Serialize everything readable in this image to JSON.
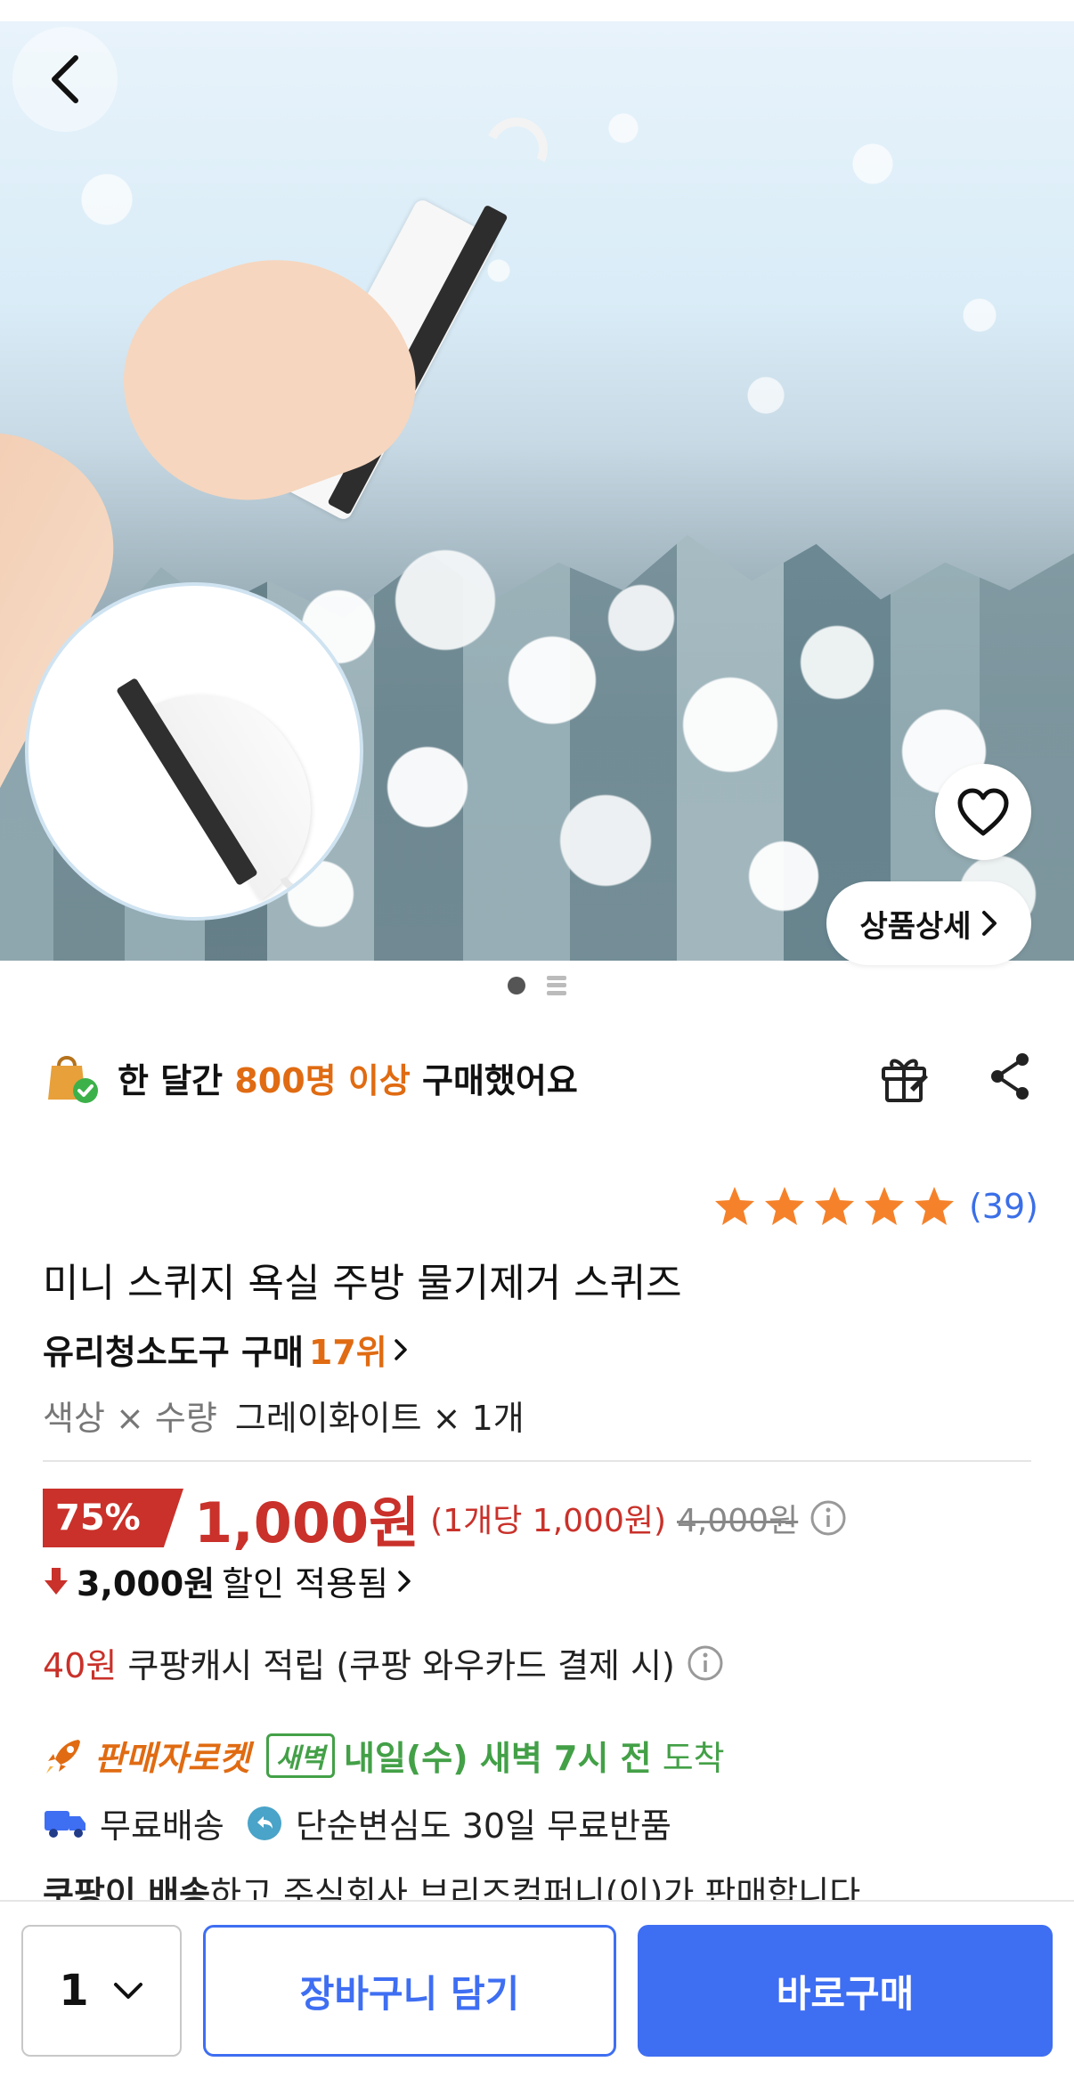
{
  "hero": {
    "detail_button_label": "상품상세"
  },
  "purchase_stat": {
    "prefix": "한 달간 ",
    "highlight": "800명 이상",
    "suffix": " 구매했어요"
  },
  "rating": {
    "stars": 5,
    "review_count": "(39)"
  },
  "product": {
    "title": "미니 스퀴지 욕실 주방 물기제거 스퀴즈",
    "rank_category": "유리청소도구 구매 ",
    "rank_value": "17위",
    "option_label": "색상 × 수량",
    "option_value": "그레이화이트 × 1개"
  },
  "price": {
    "discount_percent": "75%",
    "sale_price": "1,000원",
    "unit_price": "(1개당 1,000원)",
    "original_price": "4,000원",
    "discount_amount": "3,000원",
    "discount_applied_label": "할인 적용됨"
  },
  "cash": {
    "amount": "40원",
    "text": " 쿠팡캐시 적립 (쿠팡 와우카드 결제 시)"
  },
  "delivery": {
    "rocket_label": "판매자로켓",
    "dawn_badge": "새벽",
    "arrival_bold": "내일(수) 새벽 7시 전",
    "arrival_plain": " 도착",
    "free_shipping": "무료배송",
    "free_return": "단순변심도 30일 무료반품"
  },
  "seller": {
    "bold": "쿠팡이 배송",
    "text": "하고 주식회사 브리즈컴퍼니(이)가 판매합니다"
  },
  "bottom_bar": {
    "quantity": "1",
    "cart_label": "장바구니 담기",
    "buy_label": "바로구매"
  },
  "colors": {
    "accent_blue": "#3e6ef2",
    "sale_red": "#c9312a",
    "highlight_orange": "#e06b12",
    "delivery_green": "#43a047",
    "star_orange": "#f5822a"
  }
}
